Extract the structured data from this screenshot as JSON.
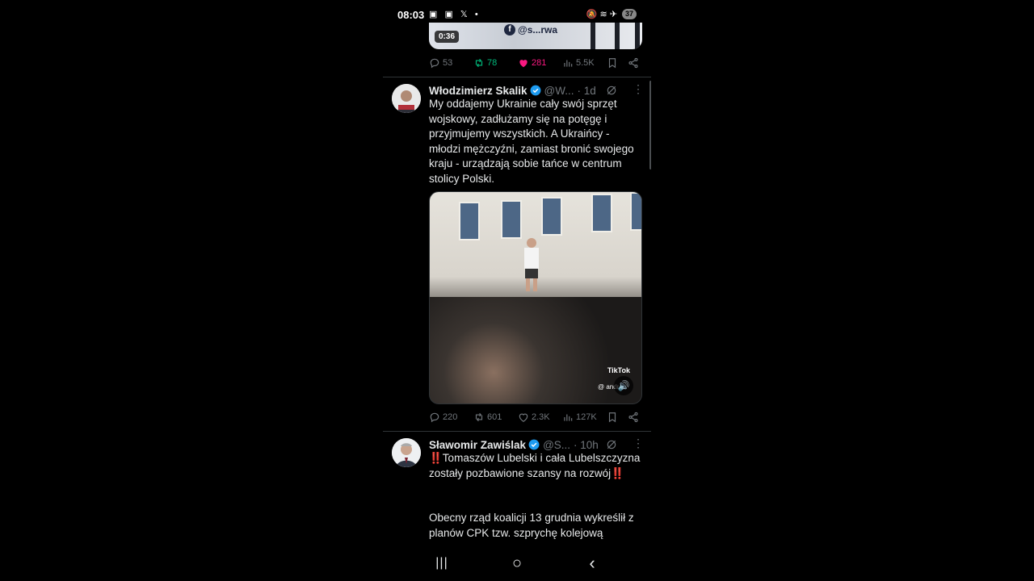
{
  "status_bar": {
    "time": "08:03",
    "left_icons": "▣ ▣ 𝕏 •",
    "right_icons": "🔕 ≋ ✈",
    "battery": "37"
  },
  "prev_tweet": {
    "video_duration": "0:36",
    "video_handle": "@s...rwa",
    "stats": {
      "replies": "53",
      "retweets": "78",
      "likes": "281",
      "views": "5.5K"
    }
  },
  "tweet1": {
    "name": "Włodzimierz Skalik",
    "handle": "@W...",
    "time": "· 1d",
    "text": "My oddajemy Ukrainie cały swój sprzęt wojskowy, zadłużamy się na potęgę i przyjmujemy wszystkich. A Ukraińcy - młodzi mężczyźni, zamiast bronić swojego kraju - urządzają sobie tańce w centrum stolicy Polski.",
    "media_watermark": "TikTok",
    "media_credit": "@ andr",
    "stats": {
      "replies": "220",
      "retweets": "601",
      "likes": "2.3K",
      "views": "127K"
    }
  },
  "tweet2": {
    "name": "Sławomir Zawiślak",
    "handle": "@S...",
    "time": "· 10h",
    "text_line1": "‼️Tomaszów Lubelski i cała Lubelszczyzna zostały pozbawione szansy na rozwój‼️",
    "text_line2": "Obecny rząd koalicji 13 grudnia wykreślił z planów CPK tzw. szprychę kolejową"
  },
  "colors": {
    "background": "#000000",
    "text": "#e7e9ea",
    "muted": "#71767b",
    "verified": "#1d9bf0",
    "retweet_active": "#00ba7c",
    "like_active": "#f91880",
    "divider": "#2f3336"
  },
  "nav": {
    "recents": "|||",
    "home": "○",
    "back": "‹"
  }
}
